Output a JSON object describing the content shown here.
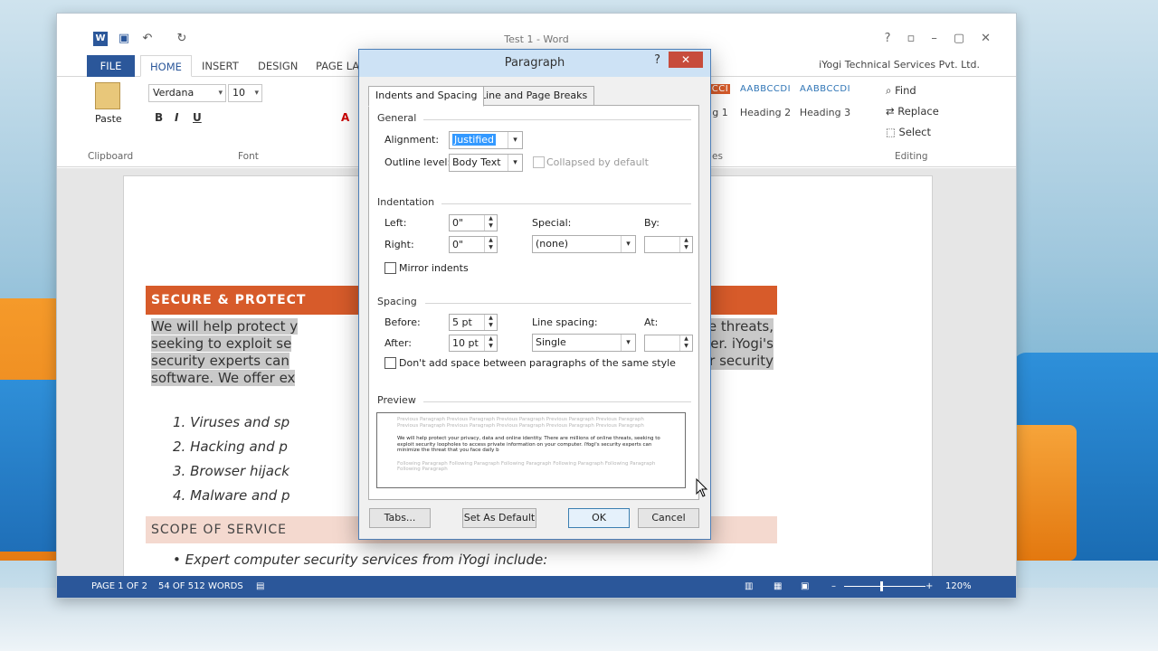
{
  "word": {
    "title": "Test 1 - Word",
    "company": "iYogi Technical Services Pvt. Ltd.",
    "tabs": [
      "FILE",
      "HOME",
      "INSERT",
      "DESIGN",
      "PAGE LAY"
    ],
    "font_name": "Verdana",
    "font_size": "10",
    "paste_label": "Paste",
    "clipboard_label": "Clipboard",
    "font_label": "Font",
    "styles_label": "es",
    "editing_label": "Editing",
    "styles": [
      {
        "sample": "CCI",
        "name": "g 1"
      },
      {
        "sample": "AABBCCDI",
        "name": "Heading 2"
      },
      {
        "sample": "AABBCCDI",
        "name": "Heading 3"
      }
    ],
    "editing": [
      "Find",
      "Replace",
      "Select"
    ],
    "doc": {
      "heading1": "SECURE & PROTECT",
      "para_line1_a": "We will help protect y",
      "para_line1_b": "s of online threats,",
      "para_line2_a": "seeking to exploit se",
      "para_line2_b": "r computer. iYogi's",
      "para_line3_a": "security experts can",
      "para_line3_b": "zing your security",
      "para_line4_a": "software. We offer ex",
      "para_line4_b": ":",
      "list": [
        "1.  Viruses and sp",
        "2.  Hacking and p",
        "3.  Browser hijack",
        "4.  Malware and p"
      ],
      "heading2": "SCOPE OF SERVICE",
      "bullet": "•   Expert computer security services from iYogi include:"
    },
    "status": {
      "page": "PAGE 1 OF 2",
      "words": "54 OF 512 WORDS",
      "zoom": "120%"
    }
  },
  "dialog": {
    "title": "Paragraph",
    "help": "?",
    "tabs": [
      "Indents and Spacing",
      "Line and Page Breaks"
    ],
    "general": {
      "section": "General",
      "alignment_label": "Alignment:",
      "alignment_value": "Justified",
      "outline_label": "Outline level:",
      "outline_value": "Body Text",
      "collapsed_label": "Collapsed by default"
    },
    "indentation": {
      "section": "Indentation",
      "left_label": "Left:",
      "left_value": "0\"",
      "right_label": "Right:",
      "right_value": "0\"",
      "special_label": "Special:",
      "special_value": "(none)",
      "by_label": "By:",
      "by_value": "",
      "mirror_label": "Mirror indents"
    },
    "spacing": {
      "section": "Spacing",
      "before_label": "Before:",
      "before_value": "5 pt",
      "after_label": "After:",
      "after_value": "10 pt",
      "line_spacing_label": "Line spacing:",
      "line_spacing_value": "Single",
      "at_label": "At:",
      "at_value": "",
      "dont_add_label": "Don't add space between paragraphs of the same style"
    },
    "preview": {
      "section": "Preview",
      "prev_text": "Previous Paragraph Previous Paragraph Previous Paragraph Previous Paragraph Previous Paragraph Previous Paragraph Previous Paragraph Previous Paragraph Previous Paragraph Previous Paragraph",
      "sample_text": "We will help protect your privacy, data and online identity. There are millions of online threats, seeking to exploit security loopholes to access private information on your computer. iYogi's security experts can minimize the threat that you face daily b",
      "next_text": "Following Paragraph Following Paragraph Following Paragraph Following Paragraph Following Paragraph Following Paragraph"
    },
    "buttons": {
      "tabs": "Tabs...",
      "default": "Set As Default",
      "ok": "OK",
      "cancel": "Cancel"
    }
  }
}
